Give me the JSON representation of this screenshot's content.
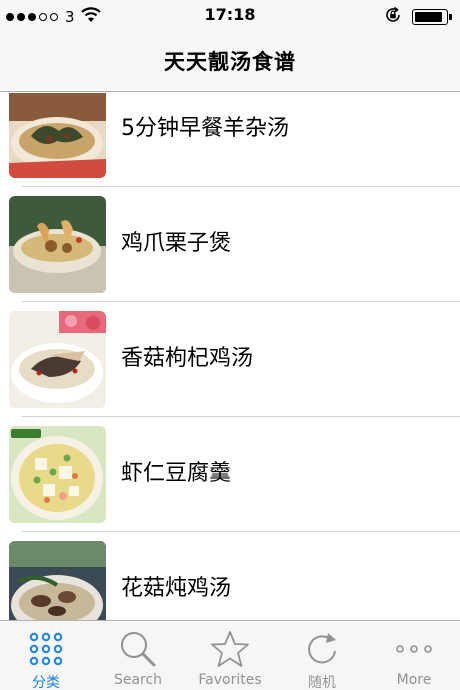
{
  "status_bar": {
    "carrier": "3",
    "time": "17:18",
    "signal_bars_filled": 3,
    "signal_bars_total": 5,
    "battery_level": 0.9,
    "icons": [
      "wifi-icon",
      "rotation-lock-icon",
      "battery-icon"
    ]
  },
  "nav": {
    "title": "天天靓汤食谱"
  },
  "recipes": [
    {
      "title": "5分钟早餐羊杂汤"
    },
    {
      "title": "鸡爪栗子煲"
    },
    {
      "title": "香菇枸杞鸡汤"
    },
    {
      "title": "虾仁豆腐羹"
    },
    {
      "title": "花菇炖鸡汤"
    }
  ],
  "tabs": [
    {
      "label": "分类",
      "icon": "grid-dots-icon",
      "active": true
    },
    {
      "label": "Search",
      "icon": "search-icon",
      "active": false
    },
    {
      "label": "Favorites",
      "icon": "star-icon",
      "active": false
    },
    {
      "label": "随机",
      "icon": "refresh-icon",
      "active": false
    },
    {
      "label": "More",
      "icon": "more-dots-icon",
      "active": false
    }
  ],
  "colors": {
    "accent": "#1a84e6",
    "inactive": "#929292",
    "bar_bg": "#f7f7f7"
  }
}
